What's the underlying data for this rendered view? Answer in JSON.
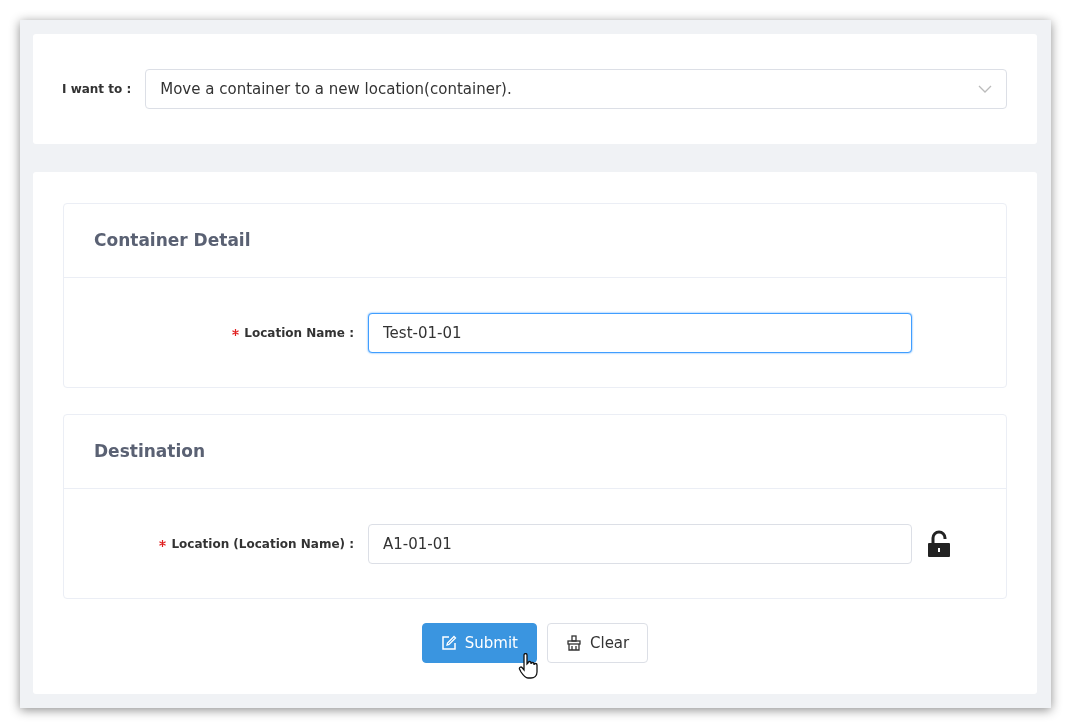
{
  "intent": {
    "label": "I want to :",
    "value": "Move a container to a new location(container)."
  },
  "sections": [
    {
      "title": "Container Detail",
      "field": {
        "label": "Location Name :",
        "required": true,
        "value": "Test-01-01",
        "focused": true
      }
    },
    {
      "title": "Destination",
      "field": {
        "label": "Location (Location Name) :",
        "required": true,
        "value": "A1-01-01",
        "focused": false,
        "lock": {
          "locked": false
        }
      }
    }
  ],
  "buttons": [
    {
      "label": "Submit",
      "kind": "primary"
    },
    {
      "label": "Clear",
      "kind": "default"
    }
  ]
}
